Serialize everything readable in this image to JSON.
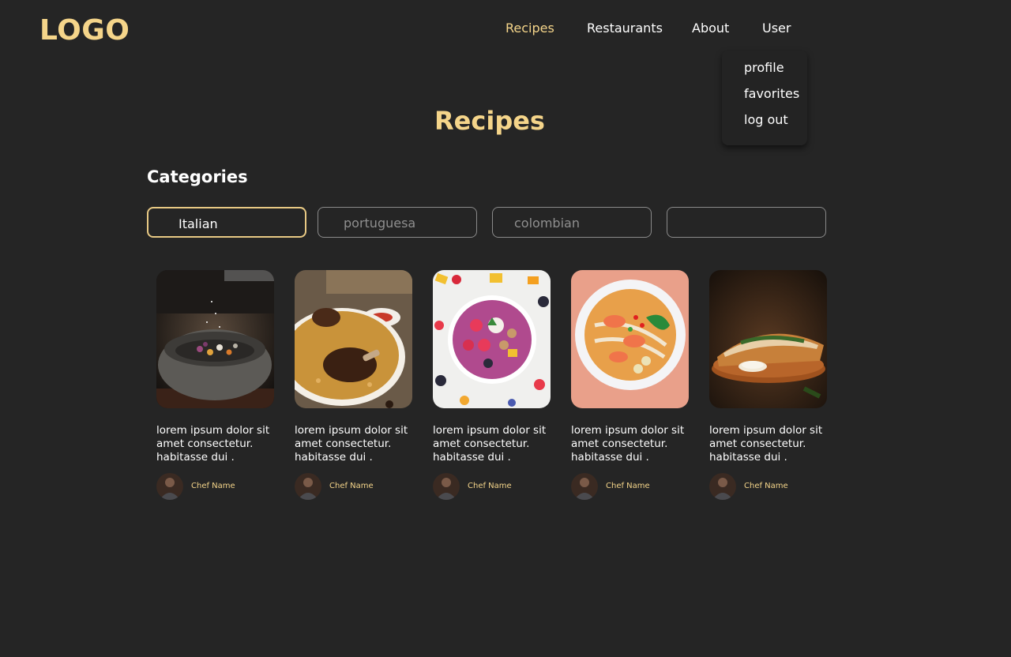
{
  "header": {
    "logo": "LOGO",
    "nav": [
      {
        "label": "Recipes",
        "active": true
      },
      {
        "label": "Restaurants"
      },
      {
        "label": "About"
      },
      {
        "label": "User"
      }
    ],
    "user_menu": [
      "profile",
      "favorites",
      "log out"
    ]
  },
  "main": {
    "title": "Recipes",
    "categories_title": "Categories",
    "categories": [
      {
        "label": "Italian",
        "selected": true
      },
      {
        "label": "portuguesa"
      },
      {
        "label": "colombian"
      },
      {
        "label": ""
      }
    ]
  },
  "cards": [
    {
      "description": "lorem ipsum dolor sit amet consectetur. habitasse dui .",
      "chef": "Chef Name",
      "image": "mortar-bowl-dish-photo"
    },
    {
      "description": "lorem ipsum dolor sit amet consectetur. habitasse dui .",
      "chef": "Chef Name",
      "image": "chicken-biryani-photo"
    },
    {
      "description": "lorem ipsum dolor sit amet consectetur. habitasse dui .",
      "chef": "Chef Name",
      "image": "fruit-smoothie-bowl-photo"
    },
    {
      "description": "lorem ipsum dolor sit amet consectetur. habitasse dui .",
      "chef": "Chef Name",
      "image": "shrimp-noodle-soup-photo"
    },
    {
      "description": "lorem ipsum dolor sit amet consectetur. habitasse dui .",
      "chef": "Chef Name",
      "image": "sandwich-board-photo"
    }
  ],
  "colors": {
    "background": "#252525",
    "accent": "#f5d58a",
    "category_border": "#8a8a8a",
    "category_active_border": "#e8c984"
  }
}
